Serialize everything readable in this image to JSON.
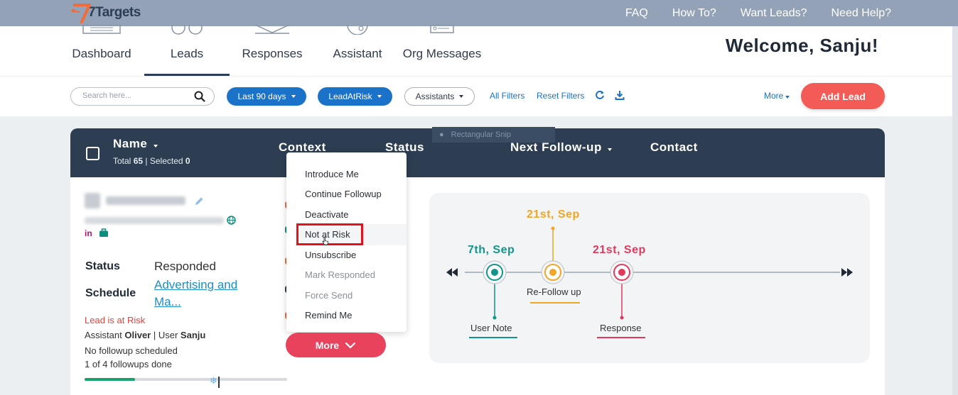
{
  "brand": {
    "name": "7Targets",
    "accent": "#f26b3a"
  },
  "top_links": [
    "FAQ",
    "How To?",
    "Want Leads?",
    "Need Help?"
  ],
  "nav": {
    "items": [
      {
        "label": "Dashboard",
        "icon": "dashboard-icon"
      },
      {
        "label": "Leads",
        "icon": "leads-icon",
        "active": true
      },
      {
        "label": "Responses",
        "icon": "responses-icon"
      },
      {
        "label": "Assistant",
        "icon": "assistant-icon"
      },
      {
        "label": "Org Messages",
        "icon": "org-messages-icon"
      }
    ],
    "welcome": "Welcome, Sanju!"
  },
  "filters": {
    "search_placeholder": "Search here...",
    "date_filter": "Last 90 days",
    "risk_filter": "LeadAtRisk",
    "assistants_filter": "Assistants",
    "all_filters": "All Filters",
    "reset_filters": "Reset Filters",
    "more": "More",
    "add_lead": "Add Lead"
  },
  "table": {
    "columns": {
      "name": "Name",
      "context": "Context",
      "status": "Status",
      "next_followup": "Next Follow-up",
      "contact": "Contact"
    },
    "total_label": "Total",
    "total": "65",
    "selected_label": "Selected",
    "selected": "0",
    "snip_overlay": "Rectangular Snip"
  },
  "lead": {
    "status_label": "Status",
    "status_value": "Responded",
    "schedule_label": "Schedule",
    "schedule_value": "Advertising and Ma...",
    "risk_text": "Lead is at Risk",
    "assistant_label": "Assistant",
    "assistant": "Oliver",
    "user_label": "User",
    "user": "Sanju",
    "followup_text": "No followup scheduled",
    "followups_done": "1 of 4 followups done",
    "progress_fraction": 0.25
  },
  "dropdown": {
    "items": [
      {
        "label": "Introduce Me",
        "disabled": false
      },
      {
        "label": "Continue Followup",
        "disabled": false
      },
      {
        "label": "Deactivate",
        "disabled": false
      },
      {
        "label": "Not at Risk",
        "disabled": false,
        "highlighted": true
      },
      {
        "label": "Unsubscribe",
        "disabled": false
      },
      {
        "label": "Mark Responded",
        "disabled": true
      },
      {
        "label": "Force Send",
        "disabled": true
      },
      {
        "label": "Remind Me",
        "disabled": false
      }
    ],
    "more_button": "More"
  },
  "timeline": {
    "events": [
      {
        "date": "7th, Sep",
        "label": "User Note",
        "color": "#12958a"
      },
      {
        "date": "21st, Sep",
        "label": "Re-Follow up",
        "color": "#f0a627"
      },
      {
        "date": "21st, Sep",
        "label": "Response",
        "color": "#e3395c"
      }
    ]
  }
}
